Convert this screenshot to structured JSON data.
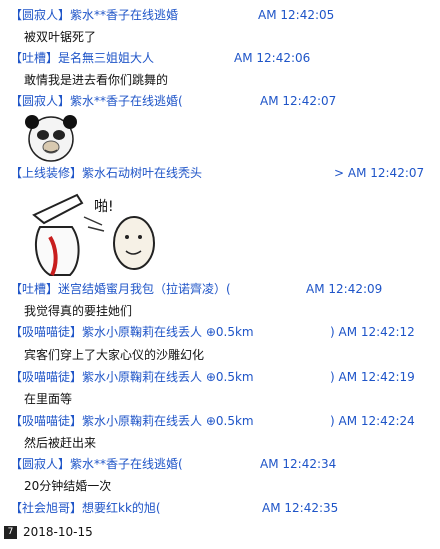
{
  "messages": [
    {
      "sender": "【圆寂人】紫水**香子在线逃婚",
      "time": "AM 12:42:05",
      "text": "被双叶锯死了"
    },
    {
      "sender": "【吐槽】是名無三姐姐大人",
      "time": "AM 12:42:06",
      "text": "敢情我是进去看你们跳舞的"
    },
    {
      "sender": "【圆寂人】紫水**香子在线逃婚(",
      "time": "AM 12:42:07",
      "sticker": "panda-face-sticker"
    },
    {
      "sender": "【上线装修】紫水石动树叶在线秃头",
      "time": "> AM 12:42:07",
      "sticker": "slap-sticker",
      "sticker_text": "啪!"
    },
    {
      "sender": "【吐槽】迷宫结婚蜜月我包（拉诺齊凌）(",
      "time": "AM 12:42:09",
      "text": "我觉得真的要挂她们"
    },
    {
      "sender": "【吸喵喵徒】紫水小原鞠莉在线丢人  ⊕0.5km",
      "time": ") AM 12:42:12",
      "text": "宾客们穿上了大家心仪的沙雕幻化"
    },
    {
      "sender": "【吸喵喵徒】紫水小原鞠莉在线丢人  ⊕0.5km",
      "time": ") AM 12:42:19",
      "text": "在里面等"
    },
    {
      "sender": "【吸喵喵徒】紫水小原鞠莉在线丢人  ⊕0.5km",
      "time": ") AM 12:42:24",
      "text": "然后被赶出来"
    },
    {
      "sender": "【圆寂人】紫水**香子在线逃婚(",
      "time": "AM 12:42:34",
      "text": "20分钟结婚一次"
    },
    {
      "sender": "【社会旭哥】想要红kk的旭(",
      "time": "AM 12:42:35"
    }
  ],
  "footer": {
    "date": "2018-10-15",
    "icon": "calendar-icon",
    "icon_glyph": "7"
  },
  "colors": {
    "sender": "#1f55c8",
    "text": "#111111"
  }
}
